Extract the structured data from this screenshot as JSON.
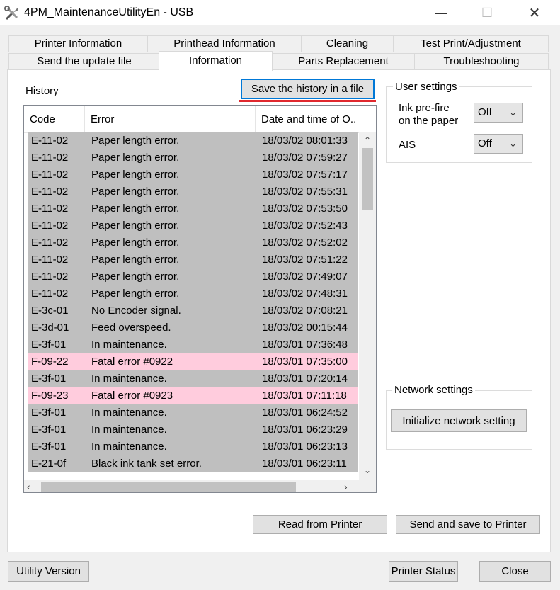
{
  "window": {
    "title": "4PM_MaintenanceUtilityEn - USB",
    "minimize": "—",
    "maximize": "☐",
    "close": "✕"
  },
  "tabs_row1": [
    "Printer Information",
    "Printhead Information",
    "Cleaning",
    "Test Print/Adjustment"
  ],
  "tabs_row2": [
    "Send the update file",
    "Information",
    "Parts Replacement",
    "Troubleshooting"
  ],
  "active_tab": "Information",
  "history": {
    "label": "History",
    "save_button": "Save the history in a file",
    "columns": [
      "Code",
      "Error",
      "Date and time of O.."
    ],
    "rows": [
      {
        "code": "E-11-02",
        "error": "Paper length error.",
        "date": "18/03/02 08:01:33",
        "highlight": false
      },
      {
        "code": "E-11-02",
        "error": "Paper length error.",
        "date": "18/03/02 07:59:27",
        "highlight": false
      },
      {
        "code": "E-11-02",
        "error": "Paper length error.",
        "date": "18/03/02 07:57:17",
        "highlight": false
      },
      {
        "code": "E-11-02",
        "error": "Paper length error.",
        "date": "18/03/02 07:55:31",
        "highlight": false
      },
      {
        "code": "E-11-02",
        "error": "Paper length error.",
        "date": "18/03/02 07:53:50",
        "highlight": false
      },
      {
        "code": "E-11-02",
        "error": "Paper length error.",
        "date": "18/03/02 07:52:43",
        "highlight": false
      },
      {
        "code": "E-11-02",
        "error": "Paper length error.",
        "date": "18/03/02 07:52:02",
        "highlight": false
      },
      {
        "code": "E-11-02",
        "error": "Paper length error.",
        "date": "18/03/02 07:51:22",
        "highlight": false
      },
      {
        "code": "E-11-02",
        "error": "Paper length error.",
        "date": "18/03/02 07:49:07",
        "highlight": false
      },
      {
        "code": "E-11-02",
        "error": "Paper length error.",
        "date": "18/03/02 07:48:31",
        "highlight": false
      },
      {
        "code": "E-3c-01",
        "error": "No Encoder signal.",
        "date": "18/03/02 07:08:21",
        "highlight": false
      },
      {
        "code": "E-3d-01",
        "error": "Feed overspeed.",
        "date": "18/03/02 00:15:44",
        "highlight": false
      },
      {
        "code": "E-3f-01",
        "error": "In maintenance.",
        "date": "18/03/01 07:36:48",
        "highlight": false
      },
      {
        "code": "F-09-22",
        "error": "Fatal error #0922",
        "date": "18/03/01 07:35:00",
        "highlight": true
      },
      {
        "code": "E-3f-01",
        "error": "In maintenance.",
        "date": "18/03/01 07:20:14",
        "highlight": false
      },
      {
        "code": "F-09-23",
        "error": "Fatal error #0923",
        "date": "18/03/01 07:11:18",
        "highlight": true
      },
      {
        "code": "E-3f-01",
        "error": "In maintenance.",
        "date": "18/03/01 06:24:52",
        "highlight": false
      },
      {
        "code": "E-3f-01",
        "error": "In maintenance.",
        "date": "18/03/01 06:23:29",
        "highlight": false
      },
      {
        "code": "E-3f-01",
        "error": "In maintenance.",
        "date": "18/03/01 06:23:13",
        "highlight": false
      },
      {
        "code": "E-21-0f",
        "error": "Black ink tank set error.",
        "date": "18/03/01 06:23:11",
        "highlight": false
      }
    ]
  },
  "user_settings": {
    "title": "User settings",
    "ink_prefire_label_1": "Ink pre-fire",
    "ink_prefire_label_2": "on the paper",
    "ink_prefire_value": "Off",
    "ais_label": "AIS",
    "ais_value": "Off"
  },
  "network_settings": {
    "title": "Network settings",
    "button": "Initialize network setting"
  },
  "buttons": {
    "read": "Read from Printer",
    "send_save": "Send and save to Printer",
    "utility_version": "Utility Version",
    "printer_status": "Printer Status",
    "close": "Close"
  },
  "colors": {
    "row_gray": "#bfbfbf",
    "row_pink": "#ffccdd",
    "accent": "#0078d7",
    "underline": "#e0282e"
  },
  "icons": {
    "app": "tools-icon",
    "scroll_up": "chevron-up-icon",
    "scroll_down": "chevron-down-icon",
    "scroll_left": "chevron-left-icon",
    "scroll_right": "chevron-right-icon"
  }
}
